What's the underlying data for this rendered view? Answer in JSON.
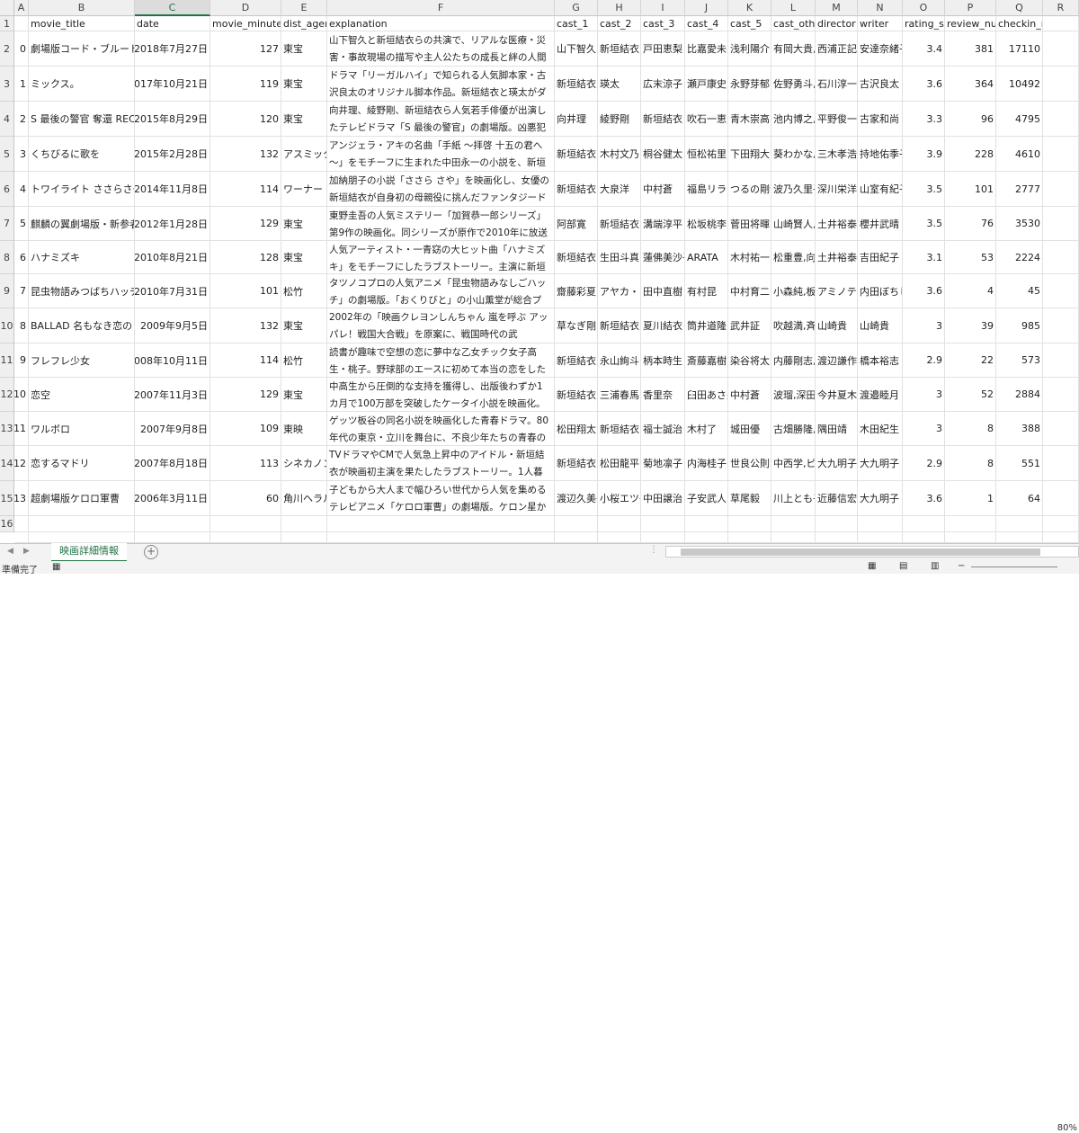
{
  "columns": [
    "A",
    "B",
    "C",
    "D",
    "E",
    "F",
    "G",
    "H",
    "I",
    "J",
    "K",
    "L",
    "M",
    "N",
    "O",
    "P",
    "Q",
    "R"
  ],
  "selected_column": "C",
  "header_row": [
    "",
    "movie_title",
    "date",
    "movie_minutes",
    "dist_agency",
    "explanation",
    "cast_1",
    "cast_2",
    "cast_3",
    "cast_4",
    "cast_5",
    "cast_other",
    "director",
    "writer",
    "rating_star",
    "review_number",
    "checkin_number",
    ""
  ],
  "rows": [
    [
      "0",
      "劇場版コード・ブルード",
      "2018年7月27日",
      "127",
      "東宝",
      "山下智久と新垣結衣らの共演で、リアルな医療・災害・事故現場の描写や主人公たちの成長と絆の人間模様を描き、2008年7月の放送以来、連続ドラマシ",
      "山下智久",
      "新垣結衣",
      "戸田恵梨",
      "比嘉愛未",
      "浅利陽介",
      "有岡大貴,",
      "西浦正記",
      "安達奈緒子",
      "3.4",
      "381",
      "17110"
    ],
    [
      "1",
      "ミックス。",
      "2017年10月21日",
      "119",
      "東宝",
      "ドラマ「リーガルハイ」で知られる人気脚本家・古沢良太のオリジナル脚本作品。新垣結衣と瑛太がダブル主演を務め、卓球を題材に、男女混合ダブルス（ミックス）を通じて巻き起こる人間模様を描い",
      "新垣結衣",
      "瑛太",
      "広末涼子",
      "瀬戸康史",
      "永野芽郁",
      "佐野勇斗,",
      "石川淳一",
      "古沢良太",
      "3.6",
      "364",
      "10492"
    ],
    [
      "2",
      "S 最後の警官 奪還 RECO",
      "2015年8月29日",
      "120",
      "東宝",
      "向井理、綾野剛、新垣結衣ら人気若手俳優が出演したテレビドラマ「S 最後の警官」の劇場版。凶悪犯罪に対処し、犯人を生きたまま確保することを至上",
      "向井理",
      "綾野剛",
      "新垣結衣",
      "吹石一恵",
      "青木崇高",
      "池内博之,",
      "平野俊一",
      "古家和尚",
      "3.3",
      "96",
      "4795"
    ],
    [
      "3",
      "くちびるに歌を",
      "2015年2月28日",
      "132",
      "アスミック",
      "アンジェラ・アキの名曲「手紙 ～拝啓 十五の君へ～」をモチーフに生まれた中田永一の小説を、新垣結衣の主演で映画化。元天才ピアニストと噂される",
      "新垣結衣",
      "木村文乃",
      "桐谷健太",
      "恒松祐里",
      "下田翔大",
      "葵わかな,",
      "三木孝浩",
      "持地佑季子",
      "3.9",
      "228",
      "4610"
    ],
    [
      "4",
      "トワイライト ささらさや",
      "2014年11月8日",
      "114",
      "ワーナー・",
      "加納朋子の小説「ささら さや」を映画化し、女優の新垣結衣が自身初の母親役に挑んだファンタジード",
      "新垣結衣",
      "大泉洋",
      "中村蒼",
      "福島リラ",
      "つるの剛士",
      "波乃久里子",
      "深川栄洋",
      "山室有紀子",
      "3.5",
      "101",
      "2777"
    ],
    [
      "5",
      "麒麟の翼劇場版・新参者",
      "2012年1月28日",
      "129",
      "東宝",
      "東野圭吾の人気ミステリー「加賀恭一郎シリーズ」第9作の映画化。同シリーズが原作で2010年に放送",
      "阿部寛",
      "新垣結衣",
      "溝端淳平",
      "松坂桃李",
      "菅田将暉",
      "山崎賢人,",
      "土井裕泰",
      "櫻井武晴",
      "3.5",
      "76",
      "3530"
    ],
    [
      "6",
      "ハナミズキ",
      "2010年8月21日",
      "128",
      "東宝",
      "人気アーティスト・一青窈の大ヒット曲「ハナミズキ」をモチーフにしたラブストーリー。主演に新垣結衣",
      "新垣結衣",
      "生田斗真",
      "蓮佛美沙子",
      "ARATA",
      "木村祐一",
      "松重豊,向",
      "土井裕泰",
      "吉田紀子",
      "3.1",
      "53",
      "2224"
    ],
    [
      "7",
      "昆虫物語みつばちハッチ",
      "2010年7月31日",
      "101",
      "松竹",
      "タツノコプロの人気アニメ「昆虫物語みなしごハッチ」の劇場版。「おくりびと」の小山薫堂が総合プ",
      "齋藤彩夏",
      "アヤカ・ウ",
      "田中直樹",
      "有村昆",
      "中村育二",
      "小森純,板",
      "アミノテツ",
      "内田ぼちし",
      "3.6",
      "4",
      "45"
    ],
    [
      "8",
      "BALLAD 名もなき恋のう",
      "2009年9月5日",
      "132",
      "東宝",
      "2002年の「映画クレヨンしんちゃん 嵐を呼ぶ アッパレ！戦国大合戦」を原案に、戦国時代の武",
      "草なぎ剛",
      "新垣結衣",
      "夏川結衣",
      "筒井道隆",
      "武井証",
      "吹越満,斉",
      "山崎貴",
      "山崎貴",
      "3",
      "39",
      "985"
    ],
    [
      "9",
      "フレフレ少女",
      "2008年10月11日",
      "114",
      "松竹",
      "読書が趣味で空想の恋に夢中な乙女チック女子高生・桃子。野球部のエースに初めて本当の恋をした",
      "新垣結衣",
      "永山絢斗",
      "柄本時生",
      "斎藤嘉樹",
      "染谷将太",
      "内藤剛志,",
      "渡辺謙作",
      "橋本裕志",
      "2.9",
      "22",
      "573"
    ],
    [
      "10",
      "恋空",
      "2007年11月3日",
      "129",
      "東宝",
      "中高生から圧倒的な支持を獲得し、出版後わずか1カ月で100万部を突破したケータイ小説を映画化。主演",
      "新垣結衣",
      "三浦春馬",
      "香里奈",
      "臼田あさ美",
      "中村蒼",
      "波瑠,深田",
      "今井夏木",
      "渡邉睦月",
      "3",
      "52",
      "2884"
    ],
    [
      "11",
      "ワルボロ",
      "2007年9月8日",
      "109",
      "東映",
      "ゲッツ板谷の同名小説を映画化した青春ドラマ。80年代の東京・立川を舞台に、不良少年たちの青春の",
      "松田翔太",
      "新垣結衣",
      "福士誠治",
      "木村了",
      "城田優",
      "古畑勝隆,",
      "隅田靖",
      "木田紀生",
      "3",
      "8",
      "388"
    ],
    [
      "12",
      "恋するマドリ",
      "2007年8月18日",
      "113",
      "シネカノン",
      "TVドラマやCMで人気急上昇中のアイドル・新垣結衣が映画初主演を果たしたラブストーリー。1人暮ら",
      "新垣結衣",
      "松田龍平",
      "菊地凛子",
      "内海桂子",
      "世良公則",
      "中西学,ピ",
      "大九明子",
      "大九明子",
      "2.9",
      "8",
      "551"
    ],
    [
      "13",
      "超劇場版ケロロ軍曹",
      "2006年3月11日",
      "60",
      "角川ヘラル",
      "子どもから大人まで幅ひろい世代から人気を集めるテレビアニメ「ケロロ軍曹」の劇場版。ケロン星か",
      "渡辺久美子",
      "小桜エツ子",
      "中田譲治",
      "子安武人",
      "草尾毅",
      "川上とも子",
      "近藤信宏",
      "大九明子",
      "3.6",
      "1",
      "64"
    ]
  ],
  "row_numbers": [
    "1",
    "2",
    "3",
    "4",
    "5",
    "6",
    "7",
    "8",
    "9",
    "10",
    "11",
    "12",
    "13",
    "14",
    "15",
    "16"
  ],
  "sheet_tab": "映画詳細情報",
  "status_text": "準備完了",
  "zoom_text": "80%"
}
